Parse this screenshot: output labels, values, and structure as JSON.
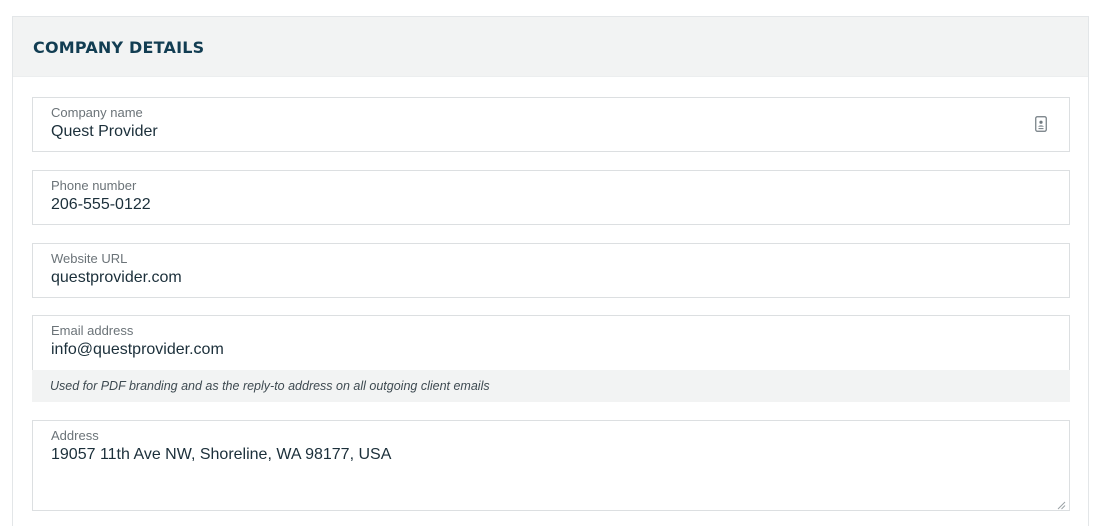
{
  "panel": {
    "title": "COMPANY DETAILS"
  },
  "fields": {
    "company_name": {
      "label": "Company name",
      "value": "Quest Provider",
      "icon": "contact-card-icon"
    },
    "phone": {
      "label": "Phone number",
      "value": "206-555-0122"
    },
    "website": {
      "label": "Website URL",
      "value": "questprovider.com"
    },
    "email": {
      "label": "Email address",
      "value": "info@questprovider.com",
      "helper": "Used for PDF branding and as the reply-to address on all outgoing client emails"
    },
    "address": {
      "label": "Address",
      "value": "19057 11th Ave NW, Shoreline, WA 98177, USA"
    }
  },
  "colors": {
    "title": "#123d52",
    "header_bg": "#f2f3f3",
    "border": "#dcdfe1",
    "label": "#6b7378",
    "value": "#1b2f3a"
  }
}
